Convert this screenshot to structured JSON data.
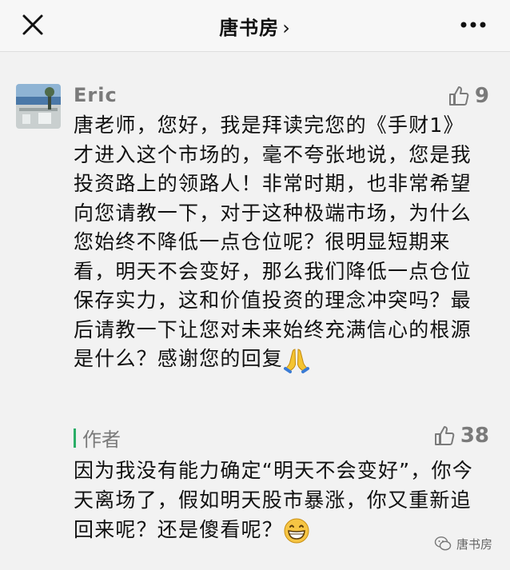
{
  "header": {
    "title": "唐书房",
    "chevron": "›"
  },
  "comment": {
    "username": "Eric",
    "likes": "9",
    "text": "唐老师，您好，我是拜读完您的《手财1》才进入这个市场的，毫不夸张地说，您是我投资路上的领路人！非常时期，也非常希望向您请教一下，对于这种极端市场，为什么您始终不降低一点仓位呢？很明显短期来看，明天不会变好，那么我们降低一点仓位保存实力，这和价值投资的理念冲突吗？最后请教一下让您对未来始终充满信心的根源是什么？感谢您的回复"
  },
  "reply": {
    "author_label": "作者",
    "likes": "38",
    "text": "因为我没有能力确定“明天不会变好”，你今天离场了，假如明天股市暴涨，你又重新追回来呢？还是傻看呢？"
  },
  "watermark": {
    "label": "唐书房"
  },
  "icons": {
    "close": "close-icon",
    "more": "more-icon",
    "like": "thumbs-up-icon",
    "pray": "pray-emoji",
    "grin": "grin-emoji",
    "wechat": "wechat-icon"
  },
  "colors": {
    "author_bar": "#2aae67",
    "muted_text": "#7a7a7a"
  }
}
